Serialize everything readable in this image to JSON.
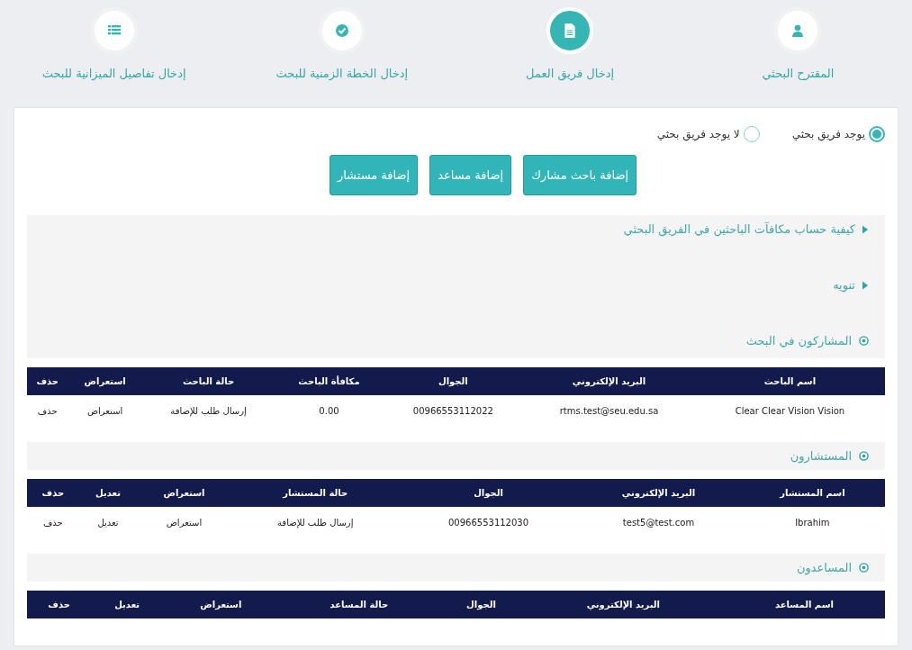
{
  "steps": [
    {
      "label": "المقترح البحثي",
      "selected": false
    },
    {
      "label": "إدخال فريق العمل",
      "selected": true
    },
    {
      "label": "إدخال الخطة الزمنية للبحث",
      "selected": false
    },
    {
      "label": "إدخال تفاصيل الميزانية للبحث",
      "selected": false
    }
  ],
  "team_options": [
    {
      "label": "يوجد فريق بحثي",
      "selected": true
    },
    {
      "label": "لا يوجد فريق بحثي",
      "selected": false
    }
  ],
  "buttons": [
    "إضافة باحث مشارك",
    "إضافة مساعد",
    "إضافة مستشار"
  ],
  "notes": [
    {
      "title": "كيفية حساب مكافآت الباحثين في الفريق البحثي",
      "expanded": false
    },
    {
      "title": "تنويه",
      "expanded": false
    }
  ],
  "sections": [
    {
      "title": "المشاركون في البحث",
      "columns": [
        "اسم الباحث",
        "البريد الإلكتروني",
        "الجوال",
        "مكافأة الباحث",
        "حالة الباحث",
        "استعراض",
        "حذف"
      ],
      "rows": [
        [
          "Clear Clear Vision Vision",
          "rtms.test@seu.edu.sa",
          "00966553112022",
          "0.00",
          "إرسال طلب للإضافة",
          "استعراض",
          "حذف"
        ]
      ]
    },
    {
      "title": "المستشارون",
      "columns": [
        "اسم المستشار",
        "البريد الإلكتروني",
        "الجوال",
        "حالة المستشار",
        "استعراض",
        "تعديل",
        "حذف"
      ],
      "rows": [
        [
          "Ibrahim",
          "test5@test.com",
          "00966553112030",
          "إرسال طلب للإضافة",
          "استعراض",
          "تعديل",
          "حذف"
        ]
      ]
    },
    {
      "title": "المساعدون",
      "columns": [
        "اسم المساعد",
        "البريد الإلكتروني",
        "الجوال",
        "حالة المساعد",
        "استعراض",
        "تعديل",
        "حذف"
      ]
    }
  ]
}
